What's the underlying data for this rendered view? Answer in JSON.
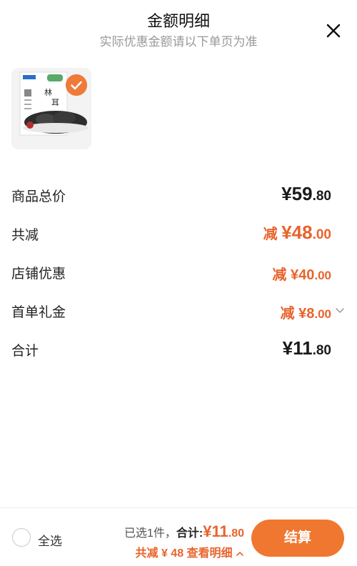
{
  "header": {
    "title": "金额明细",
    "subtitle": "实际优惠金额请以下单页为准"
  },
  "product": {
    "package_text": "东北林下黑木耳",
    "checked": true
  },
  "rows": [
    {
      "label": "商品总价",
      "prefix": "",
      "main": "¥59",
      "cents": ".80"
    },
    {
      "label": "共减",
      "prefix": "减 ",
      "main": "¥48",
      "cents": ".00"
    },
    {
      "label": "店铺优惠",
      "prefix": "减 ",
      "main": "¥40",
      "cents": ".00"
    },
    {
      "label": "首单礼金",
      "prefix": "减 ",
      "main": "¥8",
      "cents": ".00"
    },
    {
      "label": "合计",
      "prefix": "",
      "main": "¥11",
      "cents": ".80"
    }
  ],
  "footer": {
    "select_all": "全选",
    "selected_count": "已选1件，",
    "total_label": "合计:",
    "total_main": "¥11",
    "total_cents": ".80",
    "discount_text": "共减 ¥ 48 查看明细",
    "settle_label": "结算"
  },
  "colors": {
    "accent": "#e8632c",
    "button": "#f0772f"
  }
}
